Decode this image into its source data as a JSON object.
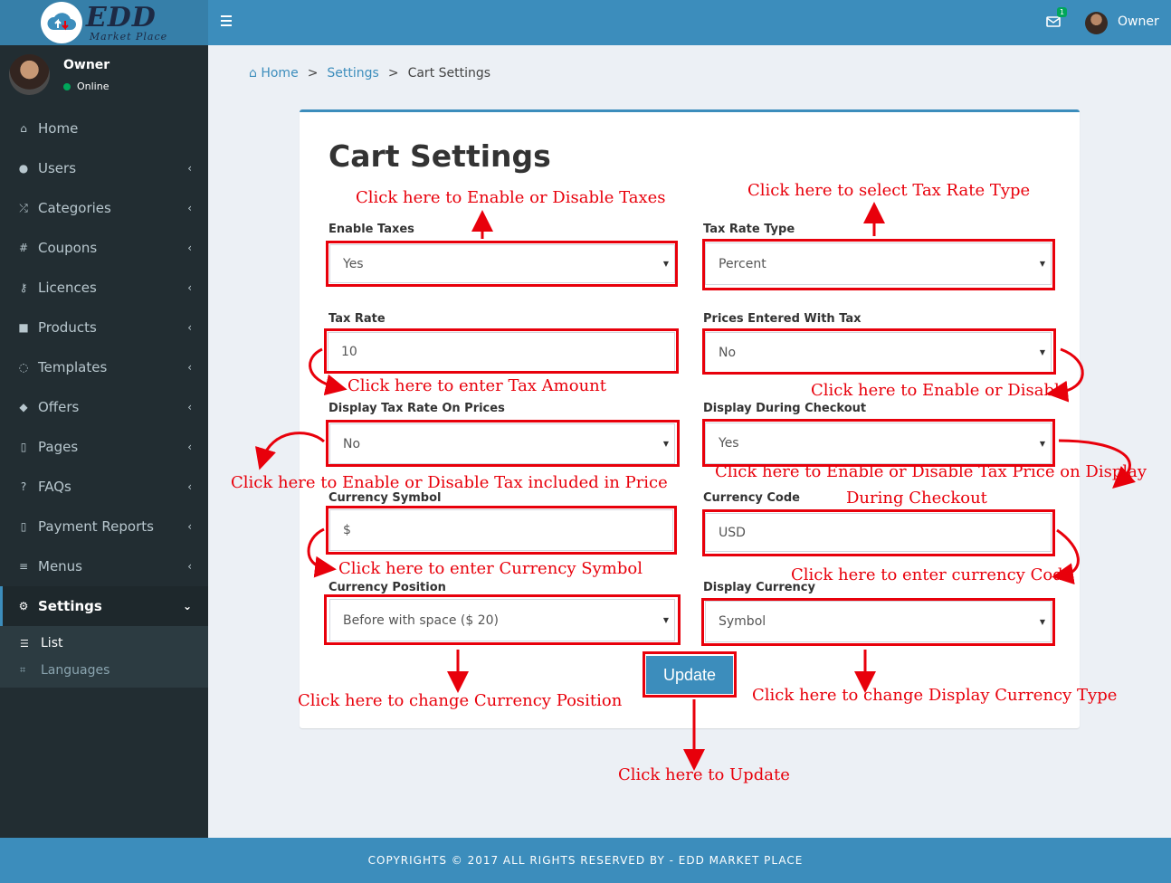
{
  "brand": {
    "name": "EDD",
    "sub": "Market Place"
  },
  "header": {
    "user": "Owner",
    "mail_count": "1"
  },
  "sidebar": {
    "user": {
      "name": "Owner",
      "status": "Online"
    },
    "items": [
      {
        "label": "Home",
        "icon": "home-icon"
      },
      {
        "label": "Users",
        "icon": "users-icon"
      },
      {
        "label": "Categories",
        "icon": "shuffle-icon"
      },
      {
        "label": "Coupons",
        "icon": "hash-icon"
      },
      {
        "label": "Licences",
        "icon": "key-icon"
      },
      {
        "label": "Products",
        "icon": "briefcase-icon"
      },
      {
        "label": "Templates",
        "icon": "comment-icon"
      },
      {
        "label": "Offers",
        "icon": "tag-icon"
      },
      {
        "label": "Pages",
        "icon": "file-icon"
      },
      {
        "label": "FAQs",
        "icon": "question-icon"
      },
      {
        "label": "Payment Reports",
        "icon": "file-icon"
      },
      {
        "label": "Menus",
        "icon": "bars-icon"
      },
      {
        "label": "Settings",
        "icon": "gear-icon"
      }
    ],
    "submenu": [
      {
        "label": "List",
        "icon": "list-icon"
      },
      {
        "label": "Languages",
        "icon": "language-icon"
      }
    ]
  },
  "breadcrumb": {
    "home": "Home",
    "settings": "Settings",
    "current": "Cart Settings",
    "sep": ">"
  },
  "form": {
    "title": "Cart Settings",
    "enable_taxes": {
      "label": "Enable Taxes",
      "value": "Yes"
    },
    "tax_rate_type": {
      "label": "Tax Rate Type",
      "value": "Percent"
    },
    "tax_rate": {
      "label": "Tax Rate",
      "value": "10"
    },
    "prices_with_tax": {
      "label": "Prices Entered With Tax",
      "value": "No"
    },
    "display_tax_rate": {
      "label": "Display Tax Rate On Prices",
      "value": "No"
    },
    "display_checkout": {
      "label": "Display During Checkout",
      "value": "Yes"
    },
    "currency_symbol": {
      "label": "Currency Symbol",
      "value": "$"
    },
    "currency_code": {
      "label": "Currency Code",
      "value": "USD"
    },
    "currency_position": {
      "label": "Currency Position",
      "value": "Before with space ($ 20)"
    },
    "display_currency": {
      "label": "Display Currency",
      "value": "Symbol"
    },
    "update": "Update"
  },
  "annotations": {
    "enable_taxes": "Click here to Enable or Disable Taxes",
    "tax_rate_type": "Click here to select Tax Rate Type",
    "tax_amount": "Click here to enter Tax Amount",
    "enable_disable": "Click here to Enable or Disable",
    "tax_in_price": "Click here to Enable or Disable Tax included in Price",
    "checkout_line1": "Click here to Enable or Disable Tax Price on Display",
    "checkout_line2": "During Checkout",
    "currency_symbol": "Click here to enter Currency Symbol",
    "currency_code": "Click here to enter currency Code",
    "currency_position": "Click here to change Currency Position",
    "display_currency": "Click here to change Display Currency Type",
    "update": "Click here to Update"
  },
  "footer": "COPYRIGHTS © 2017 ALL RIGHTS RESERVED BY - EDD MARKET PLACE",
  "colors": {
    "primary": "#3c8dbc",
    "dark": "#367fa9",
    "sidebar": "#222d32",
    "annotation": "#e8000b"
  }
}
